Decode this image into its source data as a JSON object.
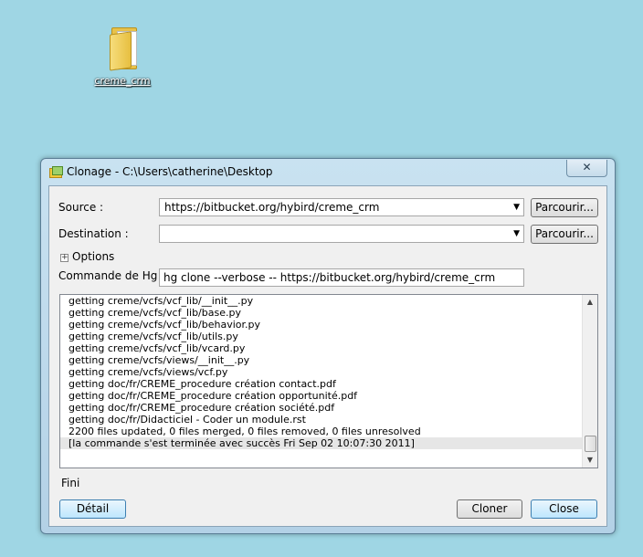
{
  "desktop": {
    "icon_label": "creme_crm"
  },
  "window": {
    "title": "Clonage - C:\\Users\\catherine\\Desktop",
    "close_label": "✕"
  },
  "form": {
    "source_label": "Source :",
    "source_value": "https://bitbucket.org/hybird/creme_crm",
    "destination_label": "Destination :",
    "destination_value": "",
    "browse_label": "Parcourir...",
    "options_toggle": "+",
    "options_label": "Options",
    "command_label": "Commande de Hg :",
    "command_value": "hg clone --verbose -- https://bitbucket.org/hybird/creme_crm"
  },
  "log": {
    "lines": [
      "getting creme/vcfs/vcf_lib/__init__.py",
      "getting creme/vcfs/vcf_lib/base.py",
      "getting creme/vcfs/vcf_lib/behavior.py",
      "getting creme/vcfs/vcf_lib/utils.py",
      "getting creme/vcfs/vcf_lib/vcard.py",
      "getting creme/vcfs/views/__init__.py",
      "getting creme/vcfs/views/vcf.py",
      "getting doc/fr/CREME_procedure création contact.pdf",
      "getting doc/fr/CREME_procedure création opportunité.pdf",
      "getting doc/fr/CREME_procedure création société.pdf",
      "getting doc/fr/Didacticiel - Coder un module.rst",
      "2200 files updated, 0 files merged, 0 files removed, 0 files unresolved",
      "[la commande s'est terminée avec succès Fri Sep 02 10:07:30 2011]"
    ]
  },
  "status": "Fini",
  "buttons": {
    "detail": "Détail",
    "clone": "Cloner",
    "close": "Close"
  }
}
